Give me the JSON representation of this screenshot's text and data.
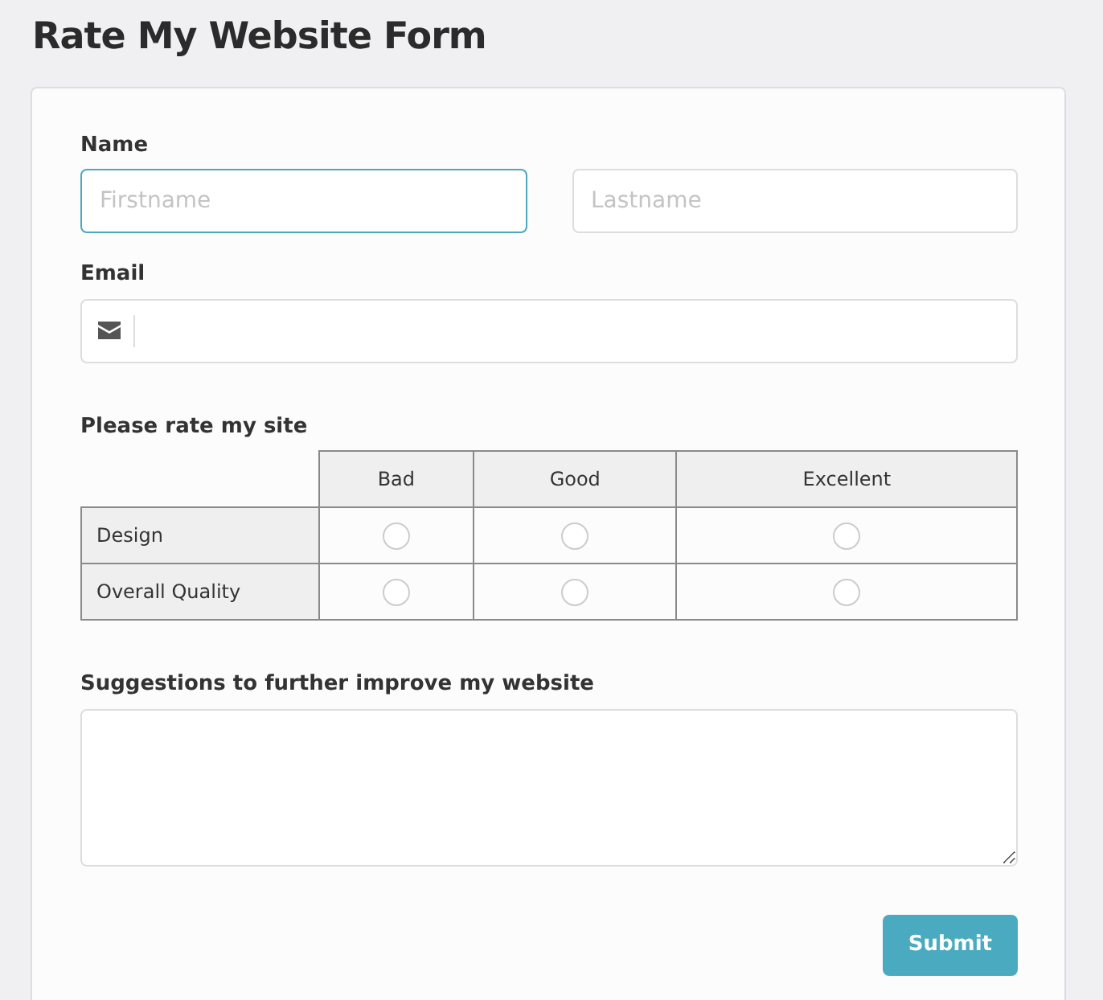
{
  "title": "Rate My Website Form",
  "name": {
    "label": "Name",
    "fields": [
      {
        "placeholder": "Firstname",
        "focused": true
      },
      {
        "placeholder": "Lastname",
        "focused": false
      }
    ]
  },
  "email": {
    "label": "Email"
  },
  "rating": {
    "label": "Please rate my site",
    "columns": [
      "Bad",
      "Good",
      "Excellent"
    ],
    "rows": [
      {
        "label": "Design",
        "options": [
          {
            "selected": false
          },
          {
            "selected": false
          },
          {
            "selected": false
          }
        ]
      },
      {
        "label": "Overall Quality",
        "options": [
          {
            "selected": false
          },
          {
            "selected": false
          },
          {
            "selected": false
          }
        ]
      }
    ]
  },
  "suggestions": {
    "label": "Suggestions to further improve my website"
  },
  "submit": "Submit"
}
